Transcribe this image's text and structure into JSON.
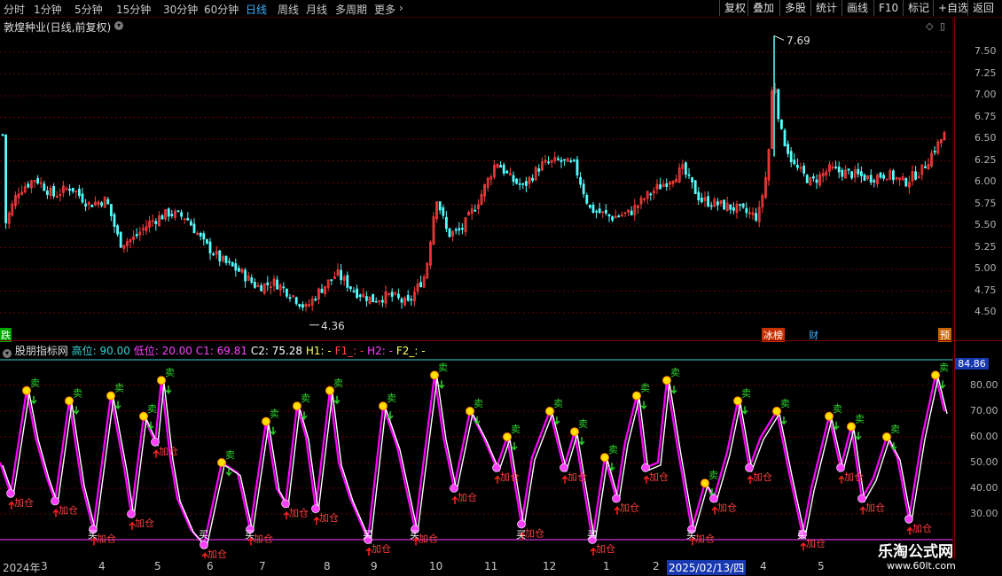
{
  "toolbar": {
    "periods": [
      "分时",
      "1分钟",
      "5分钟",
      "15分钟",
      "30分钟",
      "60分钟",
      "日线",
      "周线",
      "月线",
      "多周期",
      "更多"
    ],
    "active_period": "日线",
    "buttons": [
      "复权",
      "叠加",
      "多股",
      "统计",
      "画线",
      "F10",
      "标记",
      "+自选",
      "返回"
    ]
  },
  "stock": {
    "title": "敦煌种业(日线,前复权)"
  },
  "price_axis": {
    "labels": [
      "7.50",
      "7.25",
      "7.00",
      "6.75",
      "6.50",
      "6.25",
      "6.00",
      "5.75",
      "5.50",
      "5.25",
      "5.00",
      "4.75",
      "4.50"
    ]
  },
  "annotations": {
    "high": "7.69",
    "low": "4.36"
  },
  "event_tags": {
    "left": "跌",
    "hot": "冰榜",
    "fin": "财",
    "pre": "预"
  },
  "indicator": {
    "name": "股朋指标网",
    "high_label": "高位: 90.00",
    "low_label": "低位: 20.00",
    "c1": "C1: 69.81",
    "c2": "C2: 75.28",
    "h1": "H1: -",
    "f1": "F1_: -",
    "h2": "H2: -",
    "f2": "F2_: -",
    "current": "84.86"
  },
  "ind_axis": {
    "labels": [
      "80.00",
      "70.00",
      "60.00",
      "50.00",
      "40.00",
      "30.00"
    ]
  },
  "signals": {
    "sell": "卖",
    "buy": "买",
    "add": "加仓"
  },
  "date_axis": {
    "labels": [
      "2024年",
      "3",
      "4",
      "5",
      "6",
      "7",
      "8",
      "9",
      "10",
      "11",
      "12",
      "1",
      "2",
      "2025/02/13/四",
      "4",
      "5"
    ]
  },
  "brand": {
    "name": "乐淘公式网",
    "url": "www.60lt.com"
  },
  "colors": {
    "up": "#ff3c3c",
    "down": "#54ffff",
    "bg": "#000000",
    "grid": "#6a0000",
    "line_white": "#ffffff",
    "line_magenta": "#ff00ff"
  }
}
